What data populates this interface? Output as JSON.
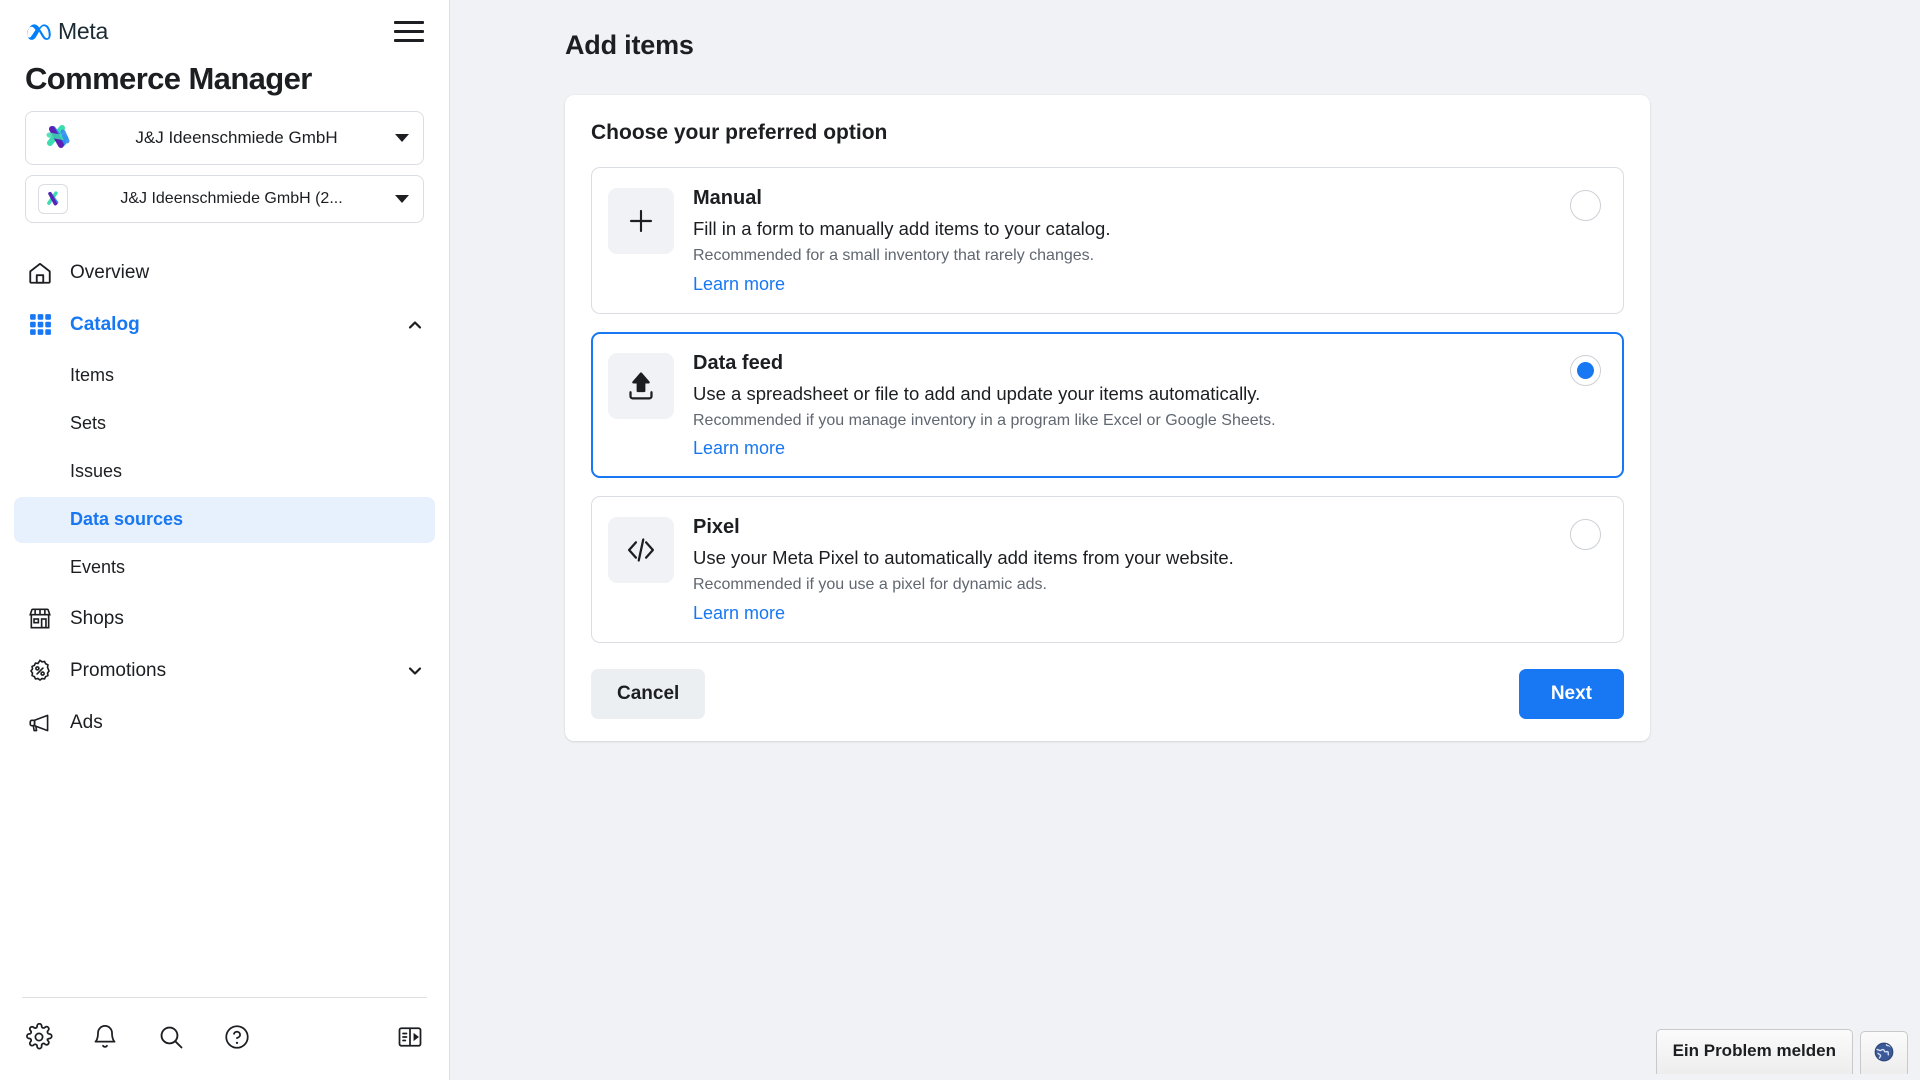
{
  "brand": {
    "logo_text": "Meta",
    "logo_icon": "meta-infinity-icon",
    "menu_icon": "hamburger-menu-icon",
    "app_title": "Commerce Manager"
  },
  "business_selector": {
    "label": "J&J Ideenschmiede GmbH",
    "avatar_icon": "business-avatar-icon",
    "caret_icon": "caret-down-icon"
  },
  "asset_selector": {
    "label": "J&J Ideenschmiede GmbH (2...",
    "avatar_icon": "catalog-avatar-icon",
    "caret_icon": "caret-down-icon"
  },
  "sidebar": {
    "items": [
      {
        "label": "Overview",
        "icon": "home-icon",
        "active": false,
        "chevron": ""
      },
      {
        "label": "Catalog",
        "icon": "grid-icon",
        "active": true,
        "chevron": "chevron-up-icon"
      },
      {
        "label": "Shops",
        "icon": "storefront-icon",
        "active": false,
        "chevron": ""
      },
      {
        "label": "Promotions",
        "icon": "percent-badge-icon",
        "active": false,
        "chevron": "chevron-down-icon"
      },
      {
        "label": "Ads",
        "icon": "megaphone-icon",
        "active": false,
        "chevron": ""
      }
    ],
    "catalog_children": [
      {
        "label": "Items",
        "selected": false
      },
      {
        "label": "Sets",
        "selected": false
      },
      {
        "label": "Issues",
        "selected": false
      },
      {
        "label": "Data sources",
        "selected": true
      },
      {
        "label": "Events",
        "selected": false
      }
    ],
    "footer_icons": [
      {
        "name": "gear-icon"
      },
      {
        "name": "bell-icon"
      },
      {
        "name": "search-icon"
      },
      {
        "name": "help-circle-icon"
      },
      {
        "name": "panel-toggle-icon"
      }
    ]
  },
  "main": {
    "page_title": "Add items",
    "card_heading": "Choose your preferred option",
    "options": [
      {
        "id": "manual",
        "title": "Manual",
        "description": "Fill in a form to manually add items to your catalog.",
        "recommendation": "Recommended for a small inventory that rarely changes.",
        "learn_more": "Learn more",
        "icon": "plus-icon",
        "selected": false
      },
      {
        "id": "data-feed",
        "title": "Data feed",
        "description": "Use a spreadsheet or file to add and update your items automatically.",
        "recommendation": "Recommended if you manage inventory in a program like Excel or Google Sheets.",
        "learn_more": "Learn more",
        "icon": "upload-icon",
        "selected": true
      },
      {
        "id": "pixel",
        "title": "Pixel",
        "description": "Use your Meta Pixel to automatically add items from your website.",
        "recommendation": "Recommended if you use a pixel for dynamic ads.",
        "learn_more": "Learn more",
        "icon": "code-brackets-icon",
        "selected": false
      }
    ],
    "cancel_label": "Cancel",
    "next_label": "Next"
  },
  "report_bar": {
    "report_label": "Ein Problem melden",
    "globe_icon": "globe-icon"
  },
  "colors": {
    "accent": "#1877f2",
    "selected_bg": "#e7f0fd",
    "page_bg": "#f0f2f5",
    "text": "#1c1e21",
    "muted": "#606770"
  }
}
